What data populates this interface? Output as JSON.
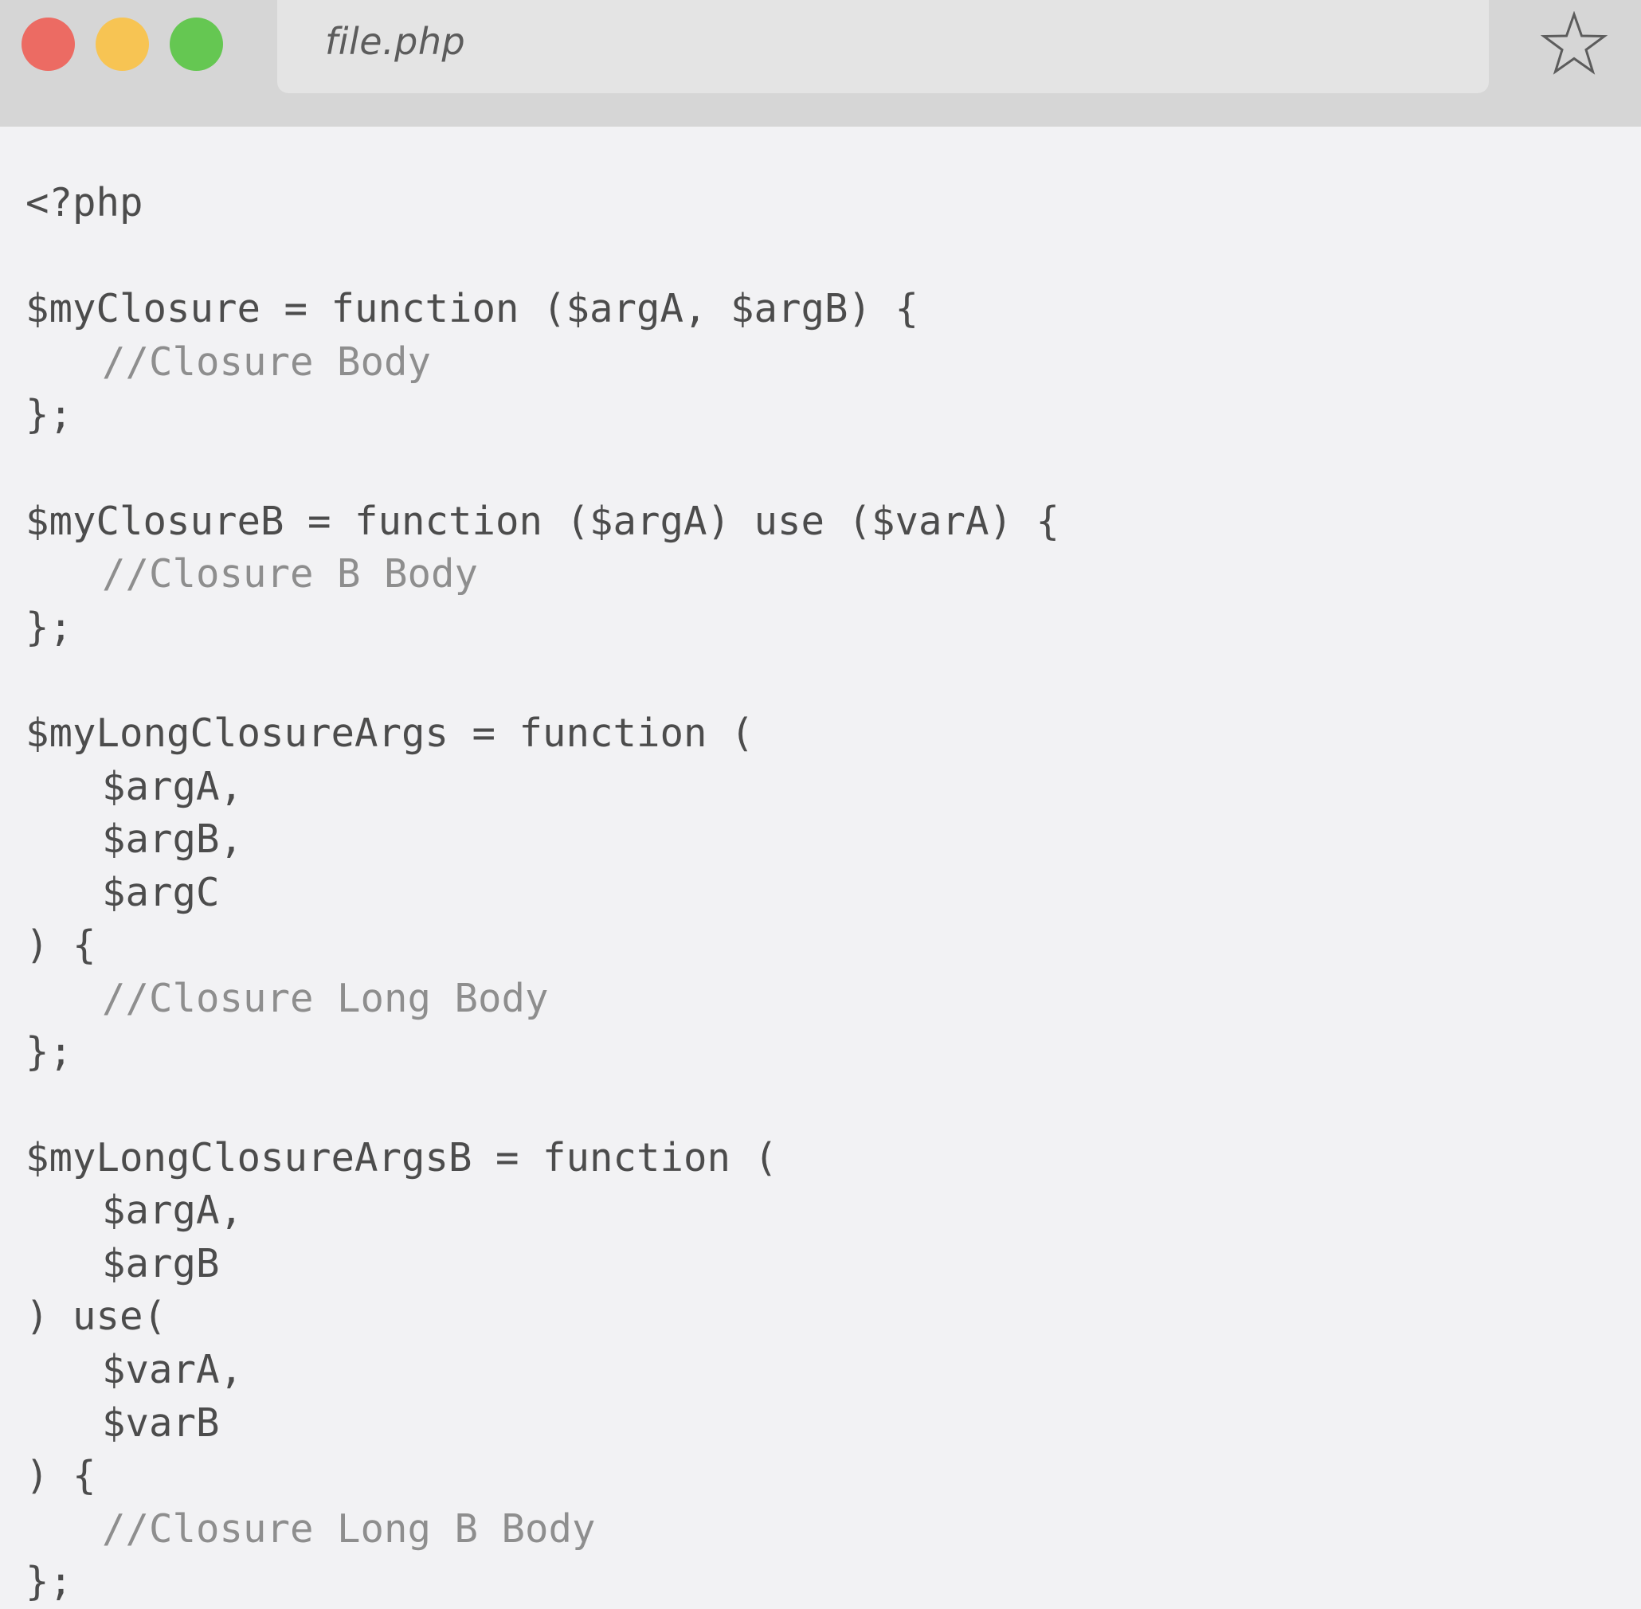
{
  "window": {
    "address_bar": {
      "filename": "file.php"
    },
    "colors": {
      "close": "#ec6b63",
      "minimize": "#f7c453",
      "maximize": "#65c752",
      "titlebar": "#d6d6d6",
      "background": "#f2f2f4",
      "code": "#4c4c4c",
      "comment": "#8e8e8e"
    },
    "icons": {
      "bookmark": "star-icon"
    }
  },
  "code": {
    "lines": [
      {
        "text": "<?php",
        "indent": false,
        "kind": "code"
      },
      {
        "text": "",
        "indent": false,
        "kind": "blank"
      },
      {
        "text": "$myClosure = function ($argA, $argB) {",
        "indent": false,
        "kind": "code"
      },
      {
        "text": "//Closure Body",
        "indent": true,
        "kind": "comment"
      },
      {
        "text": "};",
        "indent": false,
        "kind": "code"
      },
      {
        "text": "",
        "indent": false,
        "kind": "blank"
      },
      {
        "text": "$myClosureB = function ($argA) use ($varA) {",
        "indent": false,
        "kind": "code"
      },
      {
        "text": "//Closure B Body",
        "indent": true,
        "kind": "comment"
      },
      {
        "text": "};",
        "indent": false,
        "kind": "code"
      },
      {
        "text": "",
        "indent": false,
        "kind": "blank"
      },
      {
        "text": "$myLongClosureArgs = function (",
        "indent": false,
        "kind": "code"
      },
      {
        "text": "$argA,",
        "indent": true,
        "kind": "code"
      },
      {
        "text": "$argB,",
        "indent": true,
        "kind": "code"
      },
      {
        "text": "$argC",
        "indent": true,
        "kind": "code"
      },
      {
        "text": ") {",
        "indent": false,
        "kind": "code"
      },
      {
        "text": "//Closure Long Body",
        "indent": true,
        "kind": "comment"
      },
      {
        "text": "};",
        "indent": false,
        "kind": "code"
      },
      {
        "text": "",
        "indent": false,
        "kind": "blank"
      },
      {
        "text": "$myLongClosureArgsB = function (",
        "indent": false,
        "kind": "code"
      },
      {
        "text": "$argA,",
        "indent": true,
        "kind": "code"
      },
      {
        "text": "$argB",
        "indent": true,
        "kind": "code"
      },
      {
        "text": ") use(",
        "indent": false,
        "kind": "code"
      },
      {
        "text": "$varA,",
        "indent": true,
        "kind": "code"
      },
      {
        "text": "$varB",
        "indent": true,
        "kind": "code"
      },
      {
        "text": ") {",
        "indent": false,
        "kind": "code"
      },
      {
        "text": "//Closure Long B Body",
        "indent": true,
        "kind": "comment"
      },
      {
        "text": "};",
        "indent": false,
        "kind": "code"
      }
    ]
  }
}
